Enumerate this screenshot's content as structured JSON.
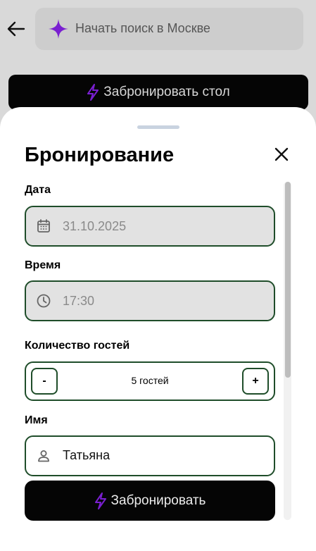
{
  "header": {
    "search_placeholder": "Начать поиск в Москве",
    "back_icon": "arrow-left-icon",
    "search_icon": "sparkle-icon",
    "sparkle_color": "#7a1fd1"
  },
  "background_action": {
    "label": "Забронировать стол",
    "icon": "lightning-icon",
    "icon_color": "#7a1fd1"
  },
  "sheet": {
    "title": "Бронирование",
    "close_icon": "close-icon",
    "date": {
      "label": "Дата",
      "value": "31.10.2025",
      "icon": "calendar-icon"
    },
    "time": {
      "label": "Время",
      "value": "17:30",
      "icon": "clock-icon"
    },
    "guests": {
      "label": "Количество гостей",
      "value": "5 гостей",
      "minus": "-",
      "plus": "+"
    },
    "name": {
      "label": "Имя",
      "value": "Татьяна",
      "icon": "person-icon"
    },
    "submit": {
      "label": "Забронировать",
      "icon": "lightning-icon"
    }
  },
  "colors": {
    "accent": "#7a1fd1",
    "field_border": "#1f4d2a",
    "button_bg": "#050505"
  }
}
